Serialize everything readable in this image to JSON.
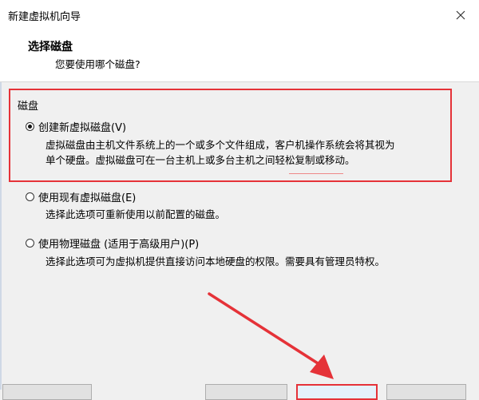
{
  "window": {
    "title": "新建虚拟机向导"
  },
  "header": {
    "title": "选择磁盘",
    "subtitle": "您要使用哪个磁盘?"
  },
  "group": {
    "label": "磁盘"
  },
  "options": [
    {
      "label": "创建新虚拟磁盘(V)",
      "checked": true,
      "desc_line1": "虚拟磁盘由主机文件系统上的一个或多个文件组成，客户机操作系统会将其视为",
      "desc_line2": "单个硬盘。虚拟磁盘可在一台主机上或多台主机之间轻松复制或移动。"
    },
    {
      "label": "使用现有虚拟磁盘(E)",
      "checked": false,
      "desc_line1": "选择此选项可重新使用以前配置的磁盘。"
    },
    {
      "label": "使用物理磁盘 (适用于高级用户)(P)",
      "checked": false,
      "desc_line1": "选择此选项可为虚拟机提供直接访问本地硬盘的权限。需要具有管理员特权。"
    }
  ],
  "annotations": {
    "highlight_color": "#e53238"
  }
}
